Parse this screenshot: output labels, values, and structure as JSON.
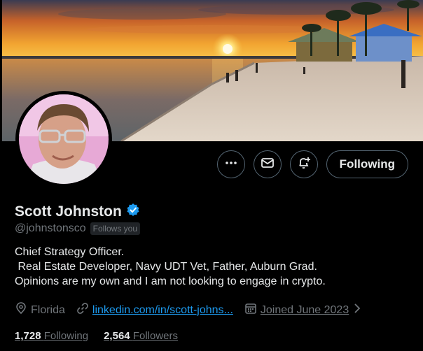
{
  "profile": {
    "name": "Scott Johnston",
    "handle": "@johnstonsco",
    "follows_you": "Follows you",
    "bio_lines": [
      "Chief Strategy Officer.",
      " Real Estate Developer, Navy UDT Vet, Father, Auburn Grad.",
      "Opinions are my own and I am not looking to engage in crypto."
    ],
    "location": "Florida",
    "website": "linkedin.com/in/scott-johns...",
    "joined": "Joined June 2023",
    "following_count": "1,728",
    "following_label": "Following",
    "followers_count": "2,564",
    "followers_label": "Followers"
  },
  "actions": {
    "following_button": "Following"
  },
  "icons": {
    "more": "more-icon",
    "message": "mail-icon",
    "notify": "bell-plus-icon",
    "verified": "verified-badge-icon",
    "location": "location-pin-icon",
    "link": "link-icon",
    "calendar": "calendar-icon"
  },
  "colors": {
    "background": "#000000",
    "text": "#e7e9ea",
    "secondary_text": "#71767b",
    "link": "#1d9bf0",
    "verified": "#1d9bf0"
  }
}
